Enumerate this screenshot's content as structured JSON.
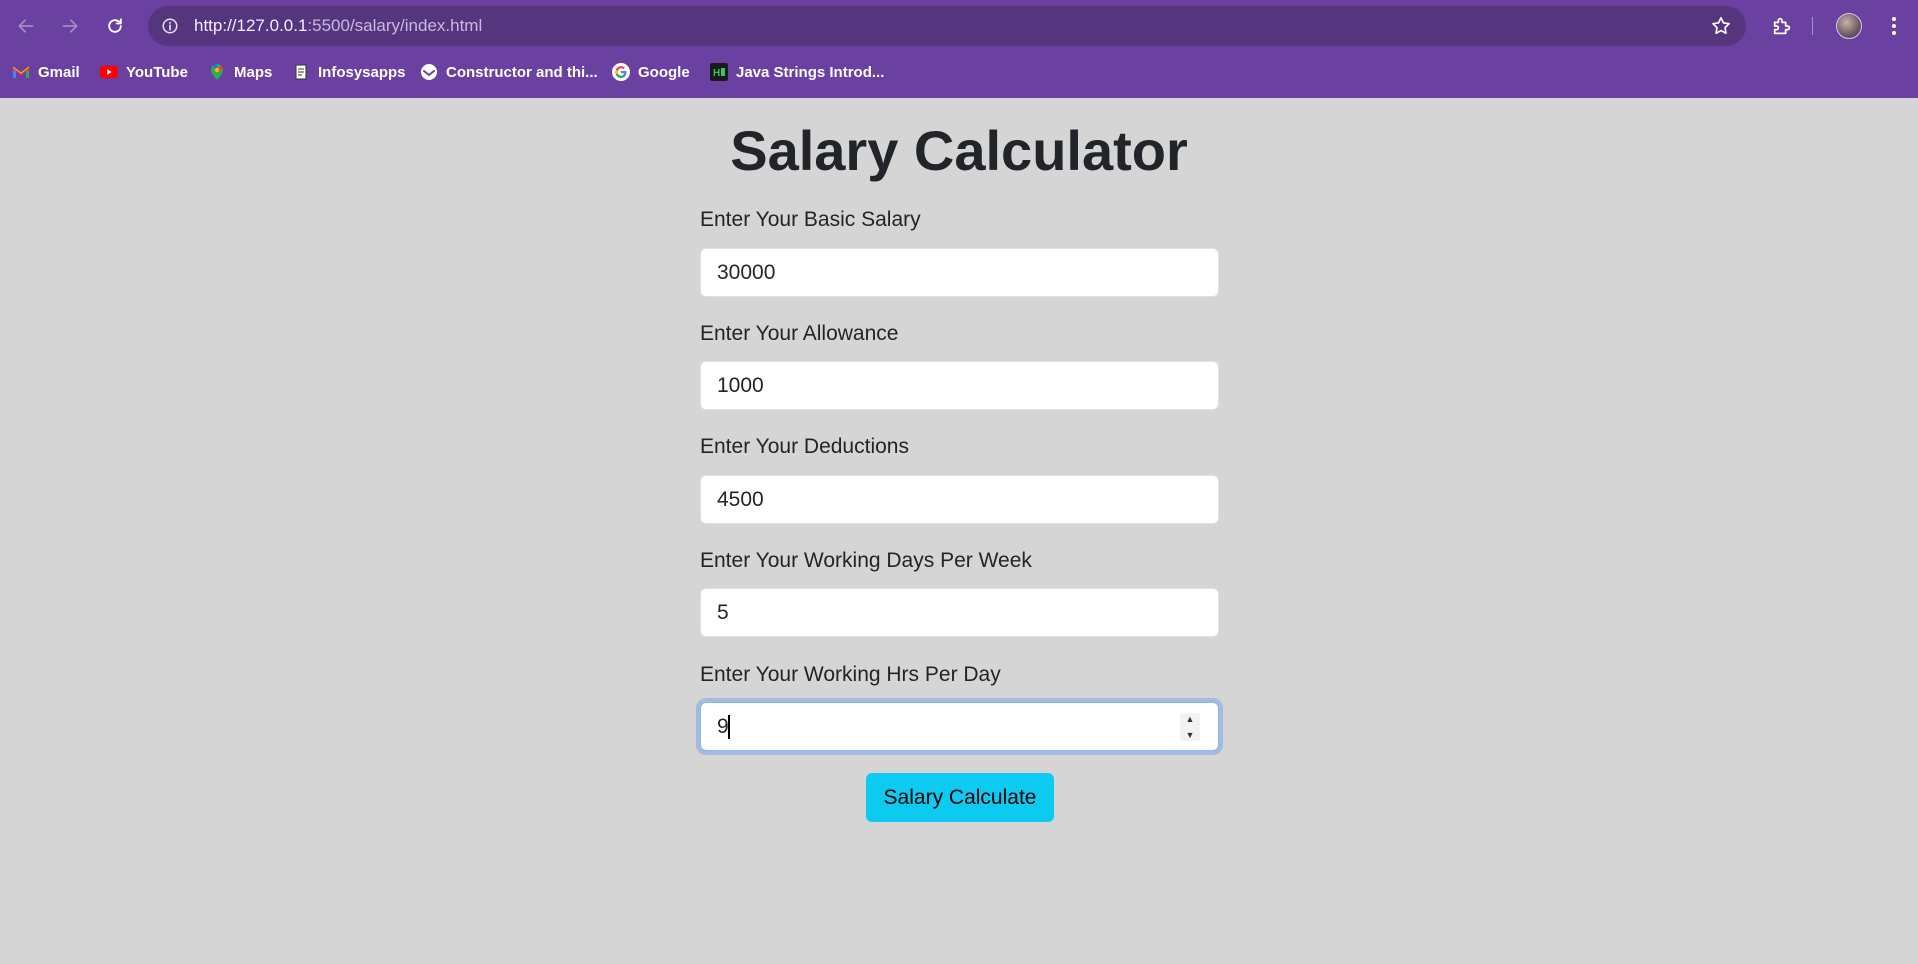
{
  "browser": {
    "url_scheme_host": "http://127.0.0.1",
    "url_rest": ":5500/salary/index.html",
    "bookmarks": [
      {
        "label": "Gmail",
        "icon": "gmail-icon"
      },
      {
        "label": "YouTube",
        "icon": "youtube-icon"
      },
      {
        "label": "Maps",
        "icon": "maps-icon"
      },
      {
        "label": "Infosysapps",
        "icon": "document-icon"
      },
      {
        "label": "Constructor and thi...",
        "icon": "site-icon"
      },
      {
        "label": "Google",
        "icon": "google-icon"
      },
      {
        "label": "Java Strings Introd...",
        "icon": "hackerrank-icon"
      }
    ]
  },
  "page": {
    "title": "Salary Calculator",
    "fields": [
      {
        "label": "Enter Your Basic Salary",
        "value": "30000"
      },
      {
        "label": "Enter Your Allowance",
        "value": "1000"
      },
      {
        "label": "Enter Your Deductions",
        "value": "4500"
      },
      {
        "label": "Enter Your Working Days Per Week",
        "value": "5"
      },
      {
        "label": "Enter Your Working Hrs Per Day",
        "value": "9"
      }
    ],
    "button_label": "Salary Calculate"
  },
  "colors": {
    "chrome": "#6a40a0",
    "omnibox": "#56357f",
    "page_bg": "#d5d5d5",
    "button": "#0dcaf0"
  }
}
